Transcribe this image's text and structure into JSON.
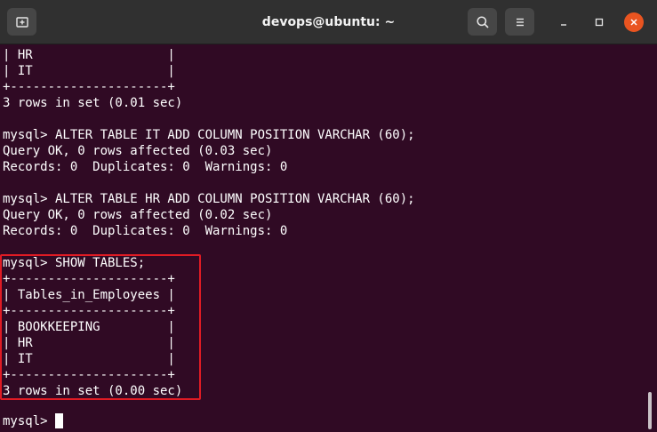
{
  "window": {
    "title": "devops@ubuntu: ~"
  },
  "titlebar": {
    "new_tab_icon": "new-tab-icon",
    "search_icon": "search-icon",
    "menu_icon": "hamburger-menu-icon",
    "minimize_icon": "minimize-icon",
    "maximize_icon": "maximize-icon",
    "close_icon": "close-icon",
    "close_color": "#e95420"
  },
  "terminal": {
    "background": "#300a24",
    "highlight_color": "#e01b24",
    "lines": [
      "| HR                  |",
      "| IT                  |",
      "+---------------------+",
      "3 rows in set (0.01 sec)",
      "",
      "mysql> ALTER TABLE IT ADD COLUMN POSITION VARCHAR (60);",
      "Query OK, 0 rows affected (0.03 sec)",
      "Records: 0  Duplicates: 0  Warnings: 0",
      "",
      "mysql> ALTER TABLE HR ADD COLUMN POSITION VARCHAR (60);",
      "Query OK, 0 rows affected (0.02 sec)",
      "Records: 0  Duplicates: 0  Warnings: 0",
      "",
      "mysql> SHOW TABLES;",
      "+---------------------+",
      "| Tables_in_Employees |",
      "+---------------------+",
      "| BOOKKEEPING         |",
      "| HR                  |",
      "| IT                  |",
      "+---------------------+",
      "3 rows in set (0.00 sec)",
      ""
    ],
    "prompt": "mysql> "
  }
}
